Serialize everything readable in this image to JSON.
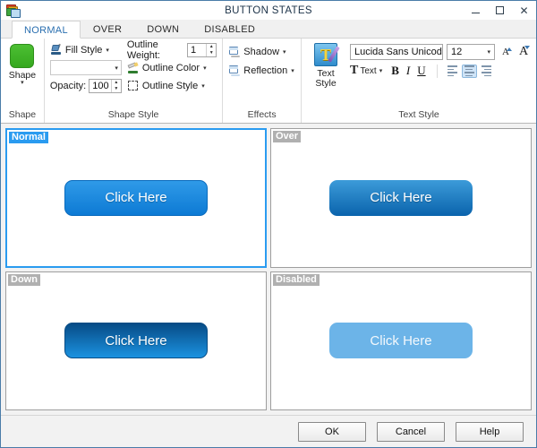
{
  "window": {
    "title": "BUTTON STATES",
    "icon": "layered-windows-icon",
    "minimize": "–",
    "maximize": "□",
    "close": "✕"
  },
  "tabs": [
    {
      "label": "NORMAL",
      "active": true
    },
    {
      "label": "OVER",
      "active": false
    },
    {
      "label": "DOWN",
      "active": false
    },
    {
      "label": "DISABLED",
      "active": false
    }
  ],
  "ribbon": {
    "shape_group": {
      "title": "Shape",
      "button_label": "Shape",
      "swatch_color": "#3fb32a",
      "caret": "▾"
    },
    "shape_style_group": {
      "title": "Shape Style",
      "fill_style_label": "Fill Style",
      "fill_style_caret": "▾",
      "fill_swatch_value": "",
      "fill_swatch_caret": "▾",
      "opacity_label": "Opacity:",
      "opacity_value": "100",
      "outline_weight_label": "Outline Weight:",
      "outline_weight_value": "1",
      "outline_color_label": "Outline Color",
      "outline_color_caret": "▾",
      "outline_style_label": "Outline Style",
      "outline_style_caret": "▾",
      "spin_up": "▲",
      "spin_down": "▼"
    },
    "effects_group": {
      "title": "Effects",
      "shadow_label": "Shadow",
      "shadow_caret": "▾",
      "reflection_label": "Reflection",
      "reflection_caret": "▾"
    },
    "text_style_group": {
      "title": "Text Style",
      "button_label_line1": "Text",
      "button_label_line2": "Style",
      "button_caret": "▾",
      "font_family": "Lucida Sans Unicode",
      "font_family_caret": "▾",
      "font_size": "12",
      "font_size_caret": "▾",
      "grow_font": "A",
      "shrink_font": "A",
      "text_chip_glyph": "T",
      "text_chip_label": "Text",
      "text_chip_caret": "▾",
      "bold": "B",
      "italic": "I",
      "underline": "U",
      "align_left": "align-left",
      "align_center": "align-center",
      "align_right": "align-right",
      "align_selected": "center"
    }
  },
  "panes": [
    {
      "label": "Normal",
      "button_text": "Click Here",
      "state": "normal",
      "selected": true
    },
    {
      "label": "Over",
      "button_text": "Click Here",
      "state": "over",
      "selected": false
    },
    {
      "label": "Down",
      "button_text": "Click Here",
      "state": "down",
      "selected": false
    },
    {
      "label": "Disabled",
      "button_text": "Click Here",
      "state": "disabled",
      "selected": false
    }
  ],
  "footer": {
    "ok": "OK",
    "cancel": "Cancel",
    "help": "Help"
  },
  "colors": {
    "accent_blue": "#2a9bf0",
    "tab_active_text": "#2a6fb0",
    "button_normal_top": "#2f9ae8",
    "button_normal_bottom": "#0d7ad4",
    "button_disabled": "#6cb4e8",
    "shape_swatch_green": "#3fb32a"
  }
}
